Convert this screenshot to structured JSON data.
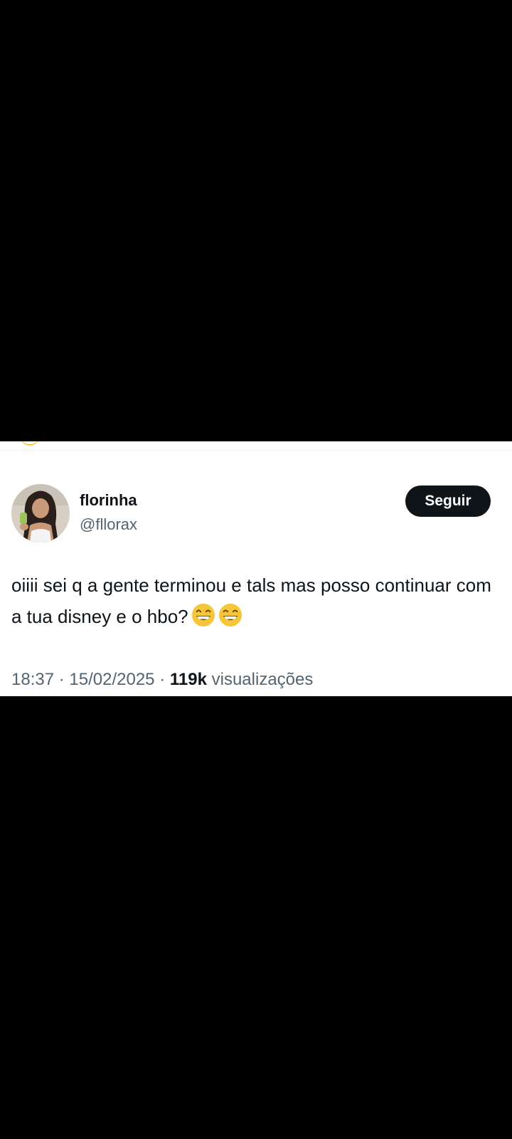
{
  "tweet": {
    "display_name": "florinha",
    "handle": "@fllorax",
    "follow_label": "Seguir",
    "text": "oiiii sei q a gente terminou e tals mas posso continuar com a tua disney e o hbo?",
    "emojis": [
      "grinning-face-with-smiling-eyes",
      "grinning-face-with-smiling-eyes"
    ],
    "time": "18:37",
    "separator": "·",
    "date": "15/02/2025",
    "views_count": "119k",
    "views_label": "visualizações"
  },
  "colors": {
    "background": "#000000",
    "card": "#ffffff",
    "text_primary": "#0f1419",
    "text_secondary": "#536471",
    "button_bg": "#0f1419",
    "button_text": "#ffffff",
    "emoji_yellow": "#f5c53a"
  }
}
